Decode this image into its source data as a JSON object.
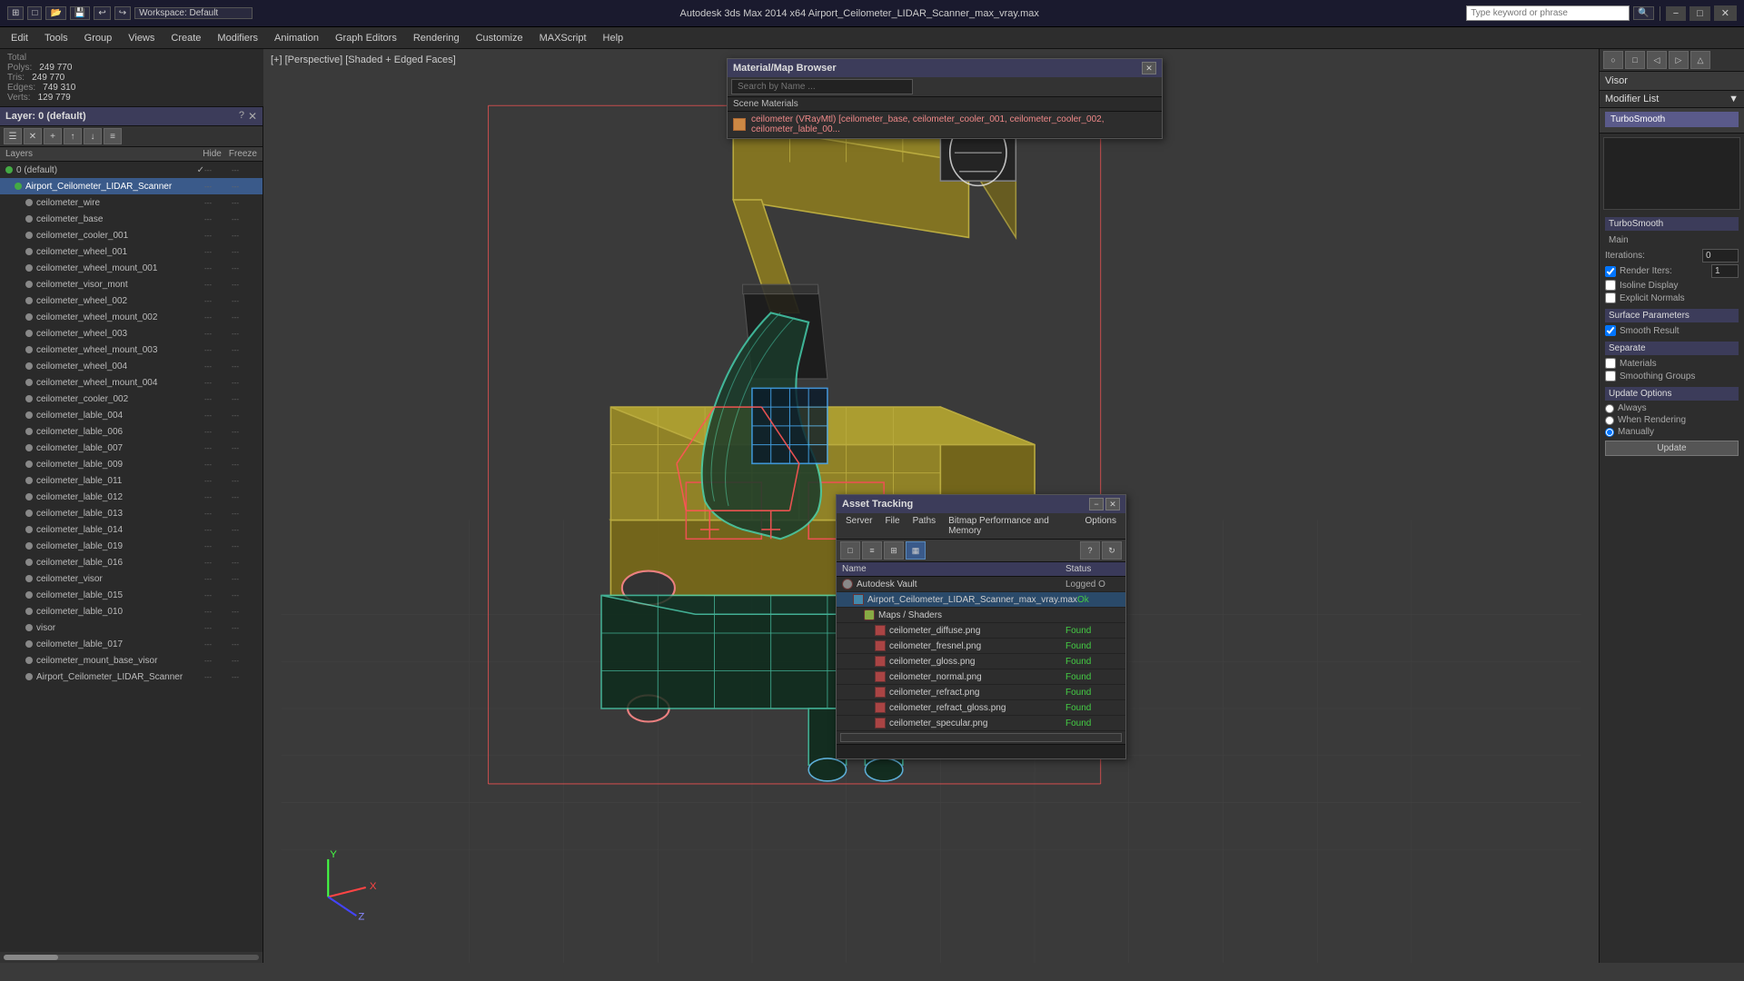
{
  "titlebar": {
    "app_title": "Autodesk 3ds Max 2014x64",
    "file_title": "Airport_Ceilometer_LIDAR_Scanner_max_vray.max",
    "full_title": "Autodesk 3ds Max 2014 x64    Airport_Ceilometer_LIDAR_Scanner_max_vray.max",
    "workspace_label": "Workspace: Default",
    "search_placeholder": "Type keyword or phrase",
    "win_minimize": "−",
    "win_restore": "□",
    "win_close": "✕"
  },
  "menu": {
    "items": [
      "Edit",
      "Tools",
      "Group",
      "Views",
      "Create",
      "Modifiers",
      "Animation",
      "Graph Editors",
      "Rendering",
      "Customize",
      "MAXScript",
      "Help"
    ]
  },
  "stats": {
    "polys_label": "Polys:",
    "polys_value": "249 770",
    "tris_label": "Tris:",
    "tris_value": "249 770",
    "edges_label": "Edges:",
    "edges_value": "749 310",
    "verts_label": "Verts:",
    "verts_value": "129 779",
    "total_label": "Total"
  },
  "layers_panel": {
    "title": "Layer: 0 (default)",
    "question_icon": "?",
    "close_icon": "✕",
    "header_layers": "Layers",
    "header_hide": "Hide",
    "header_freeze": "Freeze",
    "items": [
      {
        "label": "0 (default)",
        "level": 0,
        "selected": false,
        "icon": "folder"
      },
      {
        "label": "Airport_Ceilometer_LIDAR_Scanner",
        "level": 1,
        "selected": true,
        "icon": "folder"
      },
      {
        "label": "ceilometer_wire",
        "level": 2,
        "selected": false,
        "icon": "mesh"
      },
      {
        "label": "ceilometer_base",
        "level": 2,
        "selected": false,
        "icon": "mesh"
      },
      {
        "label": "ceilometer_cooler_001",
        "level": 2,
        "selected": false,
        "icon": "mesh"
      },
      {
        "label": "ceilometer_wheel_001",
        "level": 2,
        "selected": false,
        "icon": "mesh"
      },
      {
        "label": "ceilometer_wheel_mount_001",
        "level": 2,
        "selected": false,
        "icon": "mesh"
      },
      {
        "label": "ceilometer_visor_mont",
        "level": 2,
        "selected": false,
        "icon": "mesh"
      },
      {
        "label": "ceilometer_wheel_002",
        "level": 2,
        "selected": false,
        "icon": "mesh"
      },
      {
        "label": "ceilometer_wheel_mount_002",
        "level": 2,
        "selected": false,
        "icon": "mesh"
      },
      {
        "label": "ceilometer_wheel_003",
        "level": 2,
        "selected": false,
        "icon": "mesh"
      },
      {
        "label": "ceilometer_wheel_mount_003",
        "level": 2,
        "selected": false,
        "icon": "mesh"
      },
      {
        "label": "ceilometer_wheel_004",
        "level": 2,
        "selected": false,
        "icon": "mesh"
      },
      {
        "label": "ceilometer_wheel_mount_004",
        "level": 2,
        "selected": false,
        "icon": "mesh"
      },
      {
        "label": "ceilometer_cooler_002",
        "level": 2,
        "selected": false,
        "icon": "mesh"
      },
      {
        "label": "ceilometer_lable_004",
        "level": 2,
        "selected": false,
        "icon": "mesh"
      },
      {
        "label": "ceilometer_lable_006",
        "level": 2,
        "selected": false,
        "icon": "mesh"
      },
      {
        "label": "ceilometer_lable_007",
        "level": 2,
        "selected": false,
        "icon": "mesh"
      },
      {
        "label": "ceilometer_lable_009",
        "level": 2,
        "selected": false,
        "icon": "mesh"
      },
      {
        "label": "ceilometer_lable_011",
        "level": 2,
        "selected": false,
        "icon": "mesh"
      },
      {
        "label": "ceilometer_lable_012",
        "level": 2,
        "selected": false,
        "icon": "mesh"
      },
      {
        "label": "ceilometer_lable_013",
        "level": 2,
        "selected": false,
        "icon": "mesh"
      },
      {
        "label": "ceilometer_lable_014",
        "level": 2,
        "selected": false,
        "icon": "mesh"
      },
      {
        "label": "ceilometer_lable_019",
        "level": 2,
        "selected": false,
        "icon": "mesh"
      },
      {
        "label": "ceilometer_lable_016",
        "level": 2,
        "selected": false,
        "icon": "mesh"
      },
      {
        "label": "ceilometer_visor",
        "level": 2,
        "selected": false,
        "icon": "mesh"
      },
      {
        "label": "ceilometer_lable_015",
        "level": 2,
        "selected": false,
        "icon": "mesh"
      },
      {
        "label": "ceilometer_lable_010",
        "level": 2,
        "selected": false,
        "icon": "mesh"
      },
      {
        "label": "visor",
        "level": 2,
        "selected": false,
        "icon": "mesh"
      },
      {
        "label": "ceilometer_lable_017",
        "level": 2,
        "selected": false,
        "icon": "mesh"
      },
      {
        "label": "ceilometer_mount_base_visor",
        "level": 2,
        "selected": false,
        "icon": "mesh"
      },
      {
        "label": "Airport_Ceilometer_LIDAR_Scanner",
        "level": 2,
        "selected": false,
        "icon": "mesh"
      }
    ]
  },
  "viewport": {
    "label": "[+] [Perspective] [Shaded + Edged Faces]"
  },
  "material_panel": {
    "title": "Material/Map Browser",
    "close_icon": "✕",
    "search_placeholder": "Search by Name ...",
    "section_label": "Scene Materials",
    "material_name": "ceilometer (VRayMtl) [ceilometer_base, ceilometer_cooler_001, ceilometer_cooler_002, ceilometer_lable_00..."
  },
  "modifier_panel": {
    "visor_label": "Visor",
    "modifier_list_label": "Modifier List",
    "dropdown_icon": "▼",
    "modifier_name": "TurboSmooth",
    "sections": {
      "main": {
        "title": "TurboSmooth",
        "iterations_label": "Iterations:",
        "iterations_value": "0",
        "render_iters_label": "Render Iters:",
        "render_iters_value": "1",
        "isoline_label": "Isoline Display",
        "explicit_label": "Explicit Normals"
      },
      "surface": {
        "title": "Surface Parameters",
        "smooth_result_label": "Smooth Result",
        "smooth_result_checked": true
      },
      "separate": {
        "title": "Separate",
        "materials_label": "Materials",
        "smoothing_groups_label": "Smoothing Groups"
      },
      "update": {
        "title": "Update Options",
        "always_label": "Always",
        "when_rendering_label": "When Rendering",
        "manually_label": "Manually",
        "update_button": "Update"
      }
    }
  },
  "asset_panel": {
    "title": "Asset Tracking",
    "close_icon": "✕",
    "min_icon": "−",
    "menu_items": [
      "Server",
      "File",
      "Paths",
      "Bitmap Performance and Memory",
      "Options"
    ],
    "col_name": "Name",
    "col_status": "Status",
    "rows": [
      {
        "name": "Autodesk Vault",
        "status": "Logged O",
        "level": 0,
        "icon": "vault",
        "status_class": "loggedO"
      },
      {
        "name": "Airport_Ceilometer_LIDAR_Scanner_max_vray.max",
        "status": "Ok",
        "level": 1,
        "icon": "file",
        "status_class": "ok"
      },
      {
        "name": "Maps / Shaders",
        "status": "",
        "level": 2,
        "icon": "folder",
        "status_class": ""
      },
      {
        "name": "ceilometer_diffuse.png",
        "status": "Found",
        "level": 3,
        "icon": "map",
        "status_class": "found"
      },
      {
        "name": "ceilometer_fresnel.png",
        "status": "Found",
        "level": 3,
        "icon": "map",
        "status_class": "found"
      },
      {
        "name": "ceilometer_gloss.png",
        "status": "Found",
        "level": 3,
        "icon": "map",
        "status_class": "found"
      },
      {
        "name": "ceilometer_normal.png",
        "status": "Found",
        "level": 3,
        "icon": "map",
        "status_class": "found"
      },
      {
        "name": "ceilometer_refract.png",
        "status": "Found",
        "level": 3,
        "icon": "map",
        "status_class": "found"
      },
      {
        "name": "ceilometer_refract_gloss.png",
        "status": "Found",
        "level": 3,
        "icon": "map",
        "status_class": "found"
      },
      {
        "name": "ceilometer_specular.png",
        "status": "Found",
        "level": 3,
        "icon": "map",
        "status_class": "found"
      }
    ]
  }
}
